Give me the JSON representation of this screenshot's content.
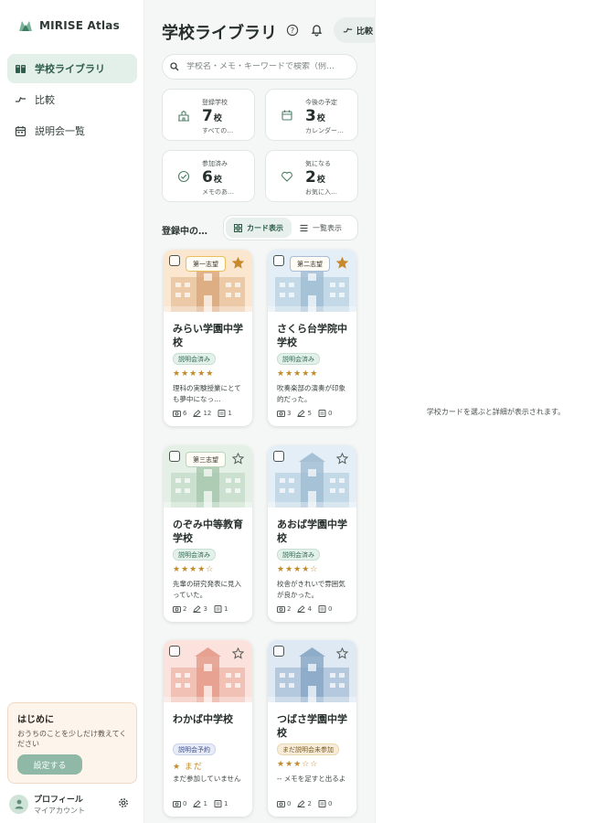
{
  "app": {
    "name": "MIRISE Atlas"
  },
  "sidebar": {
    "items": [
      {
        "label": "学校ライブラリ",
        "icon": "book-icon",
        "active": true
      },
      {
        "label": "比較",
        "icon": "compare-icon",
        "active": false
      },
      {
        "label": "説明会一覧",
        "icon": "calendar-icon",
        "active": false
      }
    ],
    "onboarding": {
      "title": "はじめに",
      "text": "おうちのことを少しだけ教えてください",
      "button": "設定する"
    },
    "profile": {
      "name": "プロフィール",
      "sub": "マイアカウント"
    }
  },
  "header": {
    "title": "学校ライブラリ",
    "compare_button": "比較"
  },
  "search": {
    "placeholder": "学校名・メモ・キーワードで検索（例…"
  },
  "stats": [
    {
      "label": "登録学校",
      "value": "7",
      "unit": "校",
      "sub": "すべての…",
      "icon": "school-icon"
    },
    {
      "label": "今後の予定",
      "value": "3",
      "unit": "校",
      "sub": "カレンダー…",
      "icon": "calendar-icon"
    },
    {
      "label": "参加済み",
      "value": "6",
      "unit": "校",
      "sub": "メモのあ…",
      "icon": "check-circle-icon"
    },
    {
      "label": "気になる",
      "value": "2",
      "unit": "校",
      "sub": "お気に入…",
      "icon": "heart-icon"
    }
  ],
  "list": {
    "heading": "登録中の…",
    "views": [
      {
        "label": "カード表示",
        "active": true
      },
      {
        "label": "一覧表示",
        "active": false
      }
    ]
  },
  "schools": [
    {
      "name": "みらい学園中学校",
      "preference": "第一志望",
      "starred": true,
      "status": "説明会済み",
      "status_type": "done",
      "rating": "★★★★★",
      "note": "理科の実験授業にとても夢中になっ…",
      "photos": "6",
      "memos": "12",
      "docs": "1",
      "theme": "warm"
    },
    {
      "name": "さくら台学院中学校",
      "preference": "第二志望",
      "starred": true,
      "status": "説明会済み",
      "status_type": "done",
      "rating": "★★★★★",
      "note": "吹奏楽部の演奏が印象的だった。",
      "photos": "3",
      "memos": "5",
      "docs": "0",
      "theme": "blue"
    },
    {
      "name": "のぞみ中等教育学校",
      "preference": "第三志望",
      "starred": false,
      "status": "説明会済み",
      "status_type": "done",
      "rating": "★★★★☆",
      "note": "先輩の研究発表に見入っていた。",
      "photos": "2",
      "memos": "3",
      "docs": "1",
      "theme": "green"
    },
    {
      "name": "あおば学園中学校",
      "preference": "",
      "starred": false,
      "status": "説明会済み",
      "status_type": "done",
      "rating": "★★★★☆",
      "note": "校舎がきれいで雰囲気が良かった。",
      "photos": "2",
      "memos": "4",
      "docs": "0",
      "theme": "blue"
    },
    {
      "name": "わかば中学校",
      "preference": "",
      "starred": false,
      "status": "説明会予約",
      "status_type": "reserved",
      "rating": "★ まだ",
      "note": "まだ参加していません",
      "photos": "0",
      "memos": "1",
      "docs": "1",
      "theme": "red"
    },
    {
      "name": "つばさ学園中学校",
      "preference": "",
      "starred": false,
      "status": "まだ説明会未参加",
      "status_type": "pending",
      "rating": "★★★☆☆",
      "note": "-- メモを足すと出るよ",
      "photos": "0",
      "memos": "2",
      "docs": "0",
      "theme": "navy"
    }
  ],
  "detail": {
    "empty_text": "学校カードを選ぶと詳細が表示されます。"
  },
  "colors": {
    "accent": "#2c5e49",
    "active_bg": "#e3efe9",
    "star": "#c28a2b",
    "badge_done_bg": "#e4f1ea",
    "badge_reserved_bg": "#e8ecf8",
    "badge_pending_bg": "#f6ecd9"
  }
}
